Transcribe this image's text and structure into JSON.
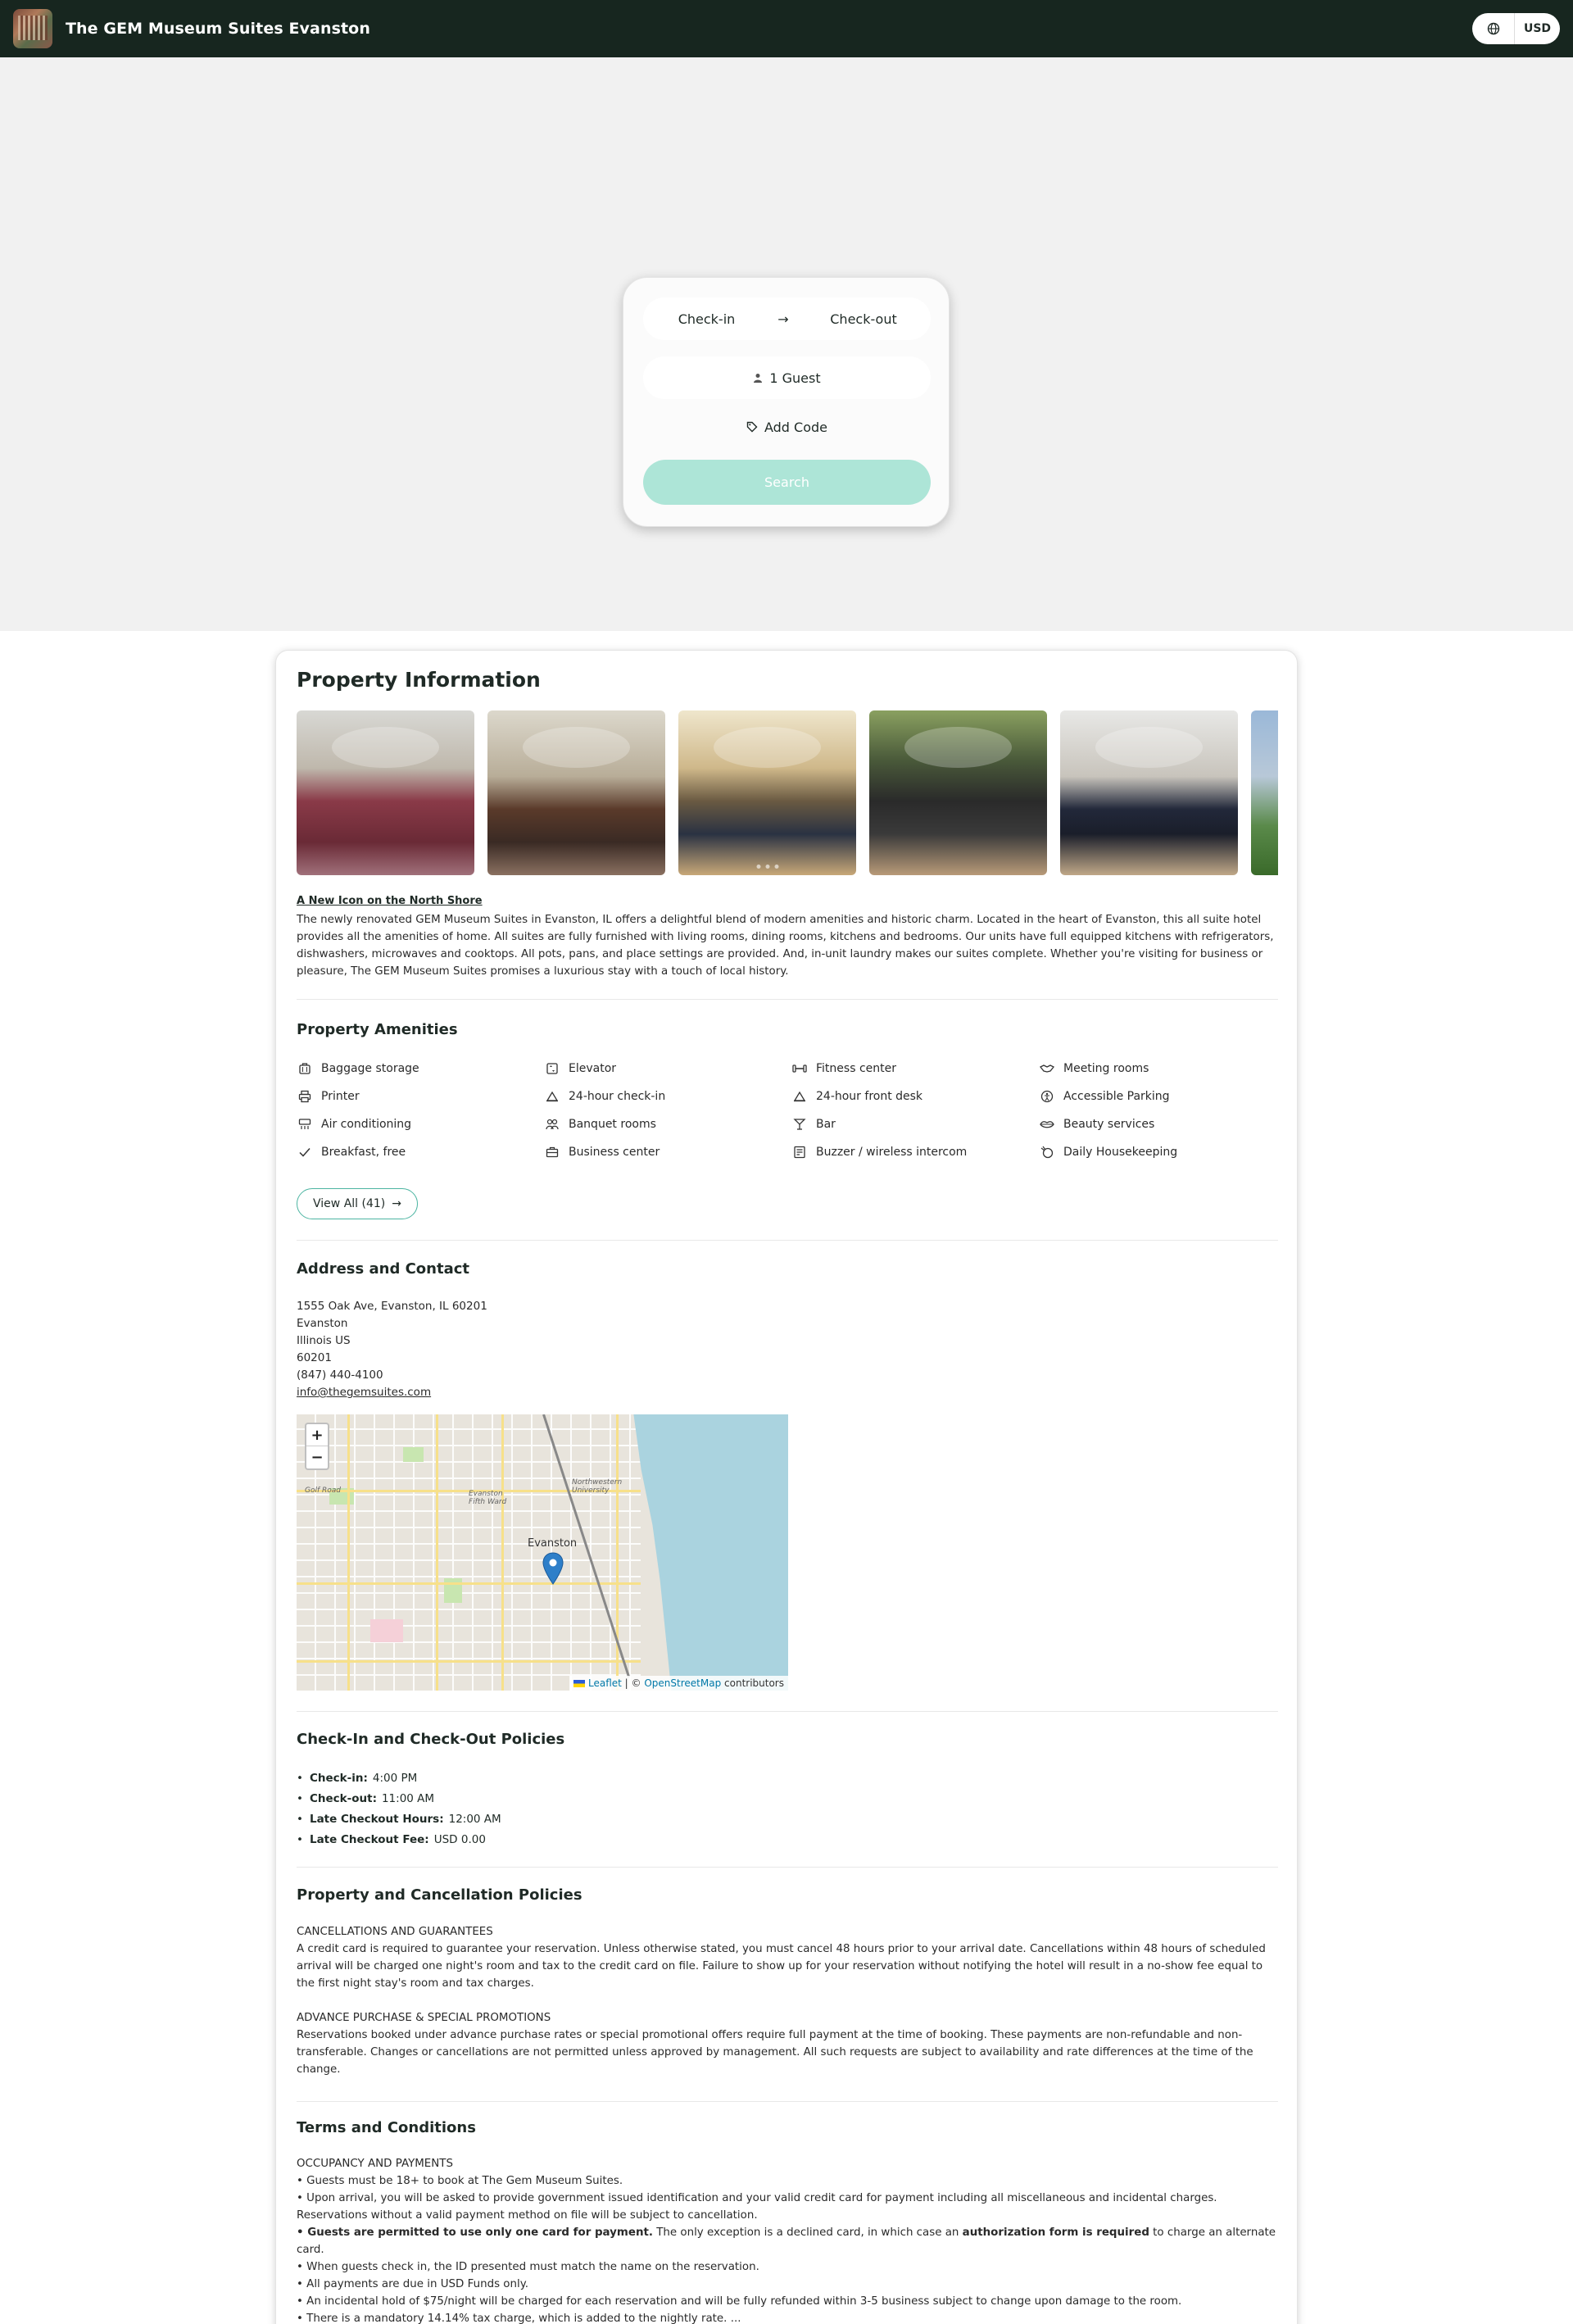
{
  "header": {
    "hotel_name": "The GEM Museum Suites Evanston",
    "currency": "USD"
  },
  "booking": {
    "check_in": "Check-in",
    "check_out": "Check-out",
    "guests": "1 Guest",
    "add_code": "Add Code",
    "search": "Search"
  },
  "property": {
    "title": "Property Information",
    "desc_title": "A New Icon on the North Shore",
    "description": "The newly renovated GEM Museum Suites in Evanston, IL offers a delightful blend of modern amenities and historic charm. Located in the heart of Evanston, this all suite hotel provides all the amenities of home.  All suites are fully furnished with living rooms, dining rooms, kitchens and bedrooms.  Our units have full equipped kitchens with refrigerators, dishwashers, microwaves and cooktops.  All pots, pans, and place settings are provided. And, in-unit laundry makes our suites complete. Whether you're visiting for business or pleasure, The GEM Museum Suites promises a luxurious stay with a touch of local history."
  },
  "amenities": {
    "title": "Property Amenities",
    "items": [
      {
        "label": "Baggage storage",
        "icon": "luggage-icon"
      },
      {
        "label": "Elevator",
        "icon": "elevator-icon"
      },
      {
        "label": "Fitness center",
        "icon": "dumbbell-icon"
      },
      {
        "label": "Meeting rooms",
        "icon": "handshake-icon"
      },
      {
        "label": "Printer",
        "icon": "printer-icon"
      },
      {
        "label": "24-hour check-in",
        "icon": "bell-icon"
      },
      {
        "label": "24-hour front desk",
        "icon": "bell-icon"
      },
      {
        "label": "Accessible Parking",
        "icon": "accessibility-icon"
      },
      {
        "label": "Air conditioning",
        "icon": "air-conditioner-icon"
      },
      {
        "label": "Banquet rooms",
        "icon": "banquet-icon"
      },
      {
        "label": "Bar",
        "icon": "cocktail-icon"
      },
      {
        "label": "Beauty services",
        "icon": "lips-icon"
      },
      {
        "label": "Breakfast, free",
        "icon": "check-icon"
      },
      {
        "label": "Business center",
        "icon": "briefcase-icon"
      },
      {
        "label": "Buzzer / wireless intercom",
        "icon": "intercom-icon"
      },
      {
        "label": "Daily Housekeeping",
        "icon": "housekeeping-icon"
      }
    ],
    "view_all": "View All (41)"
  },
  "address": {
    "title": "Address and Contact",
    "street": "1555 Oak Ave, Evanston, IL 60201",
    "city": "Evanston",
    "state": "Illinois US",
    "zip": "60201",
    "phone": "(847) 440-4100",
    "email": "info@thegemsuites.com"
  },
  "map": {
    "zoom_in": "+",
    "zoom_out": "−",
    "city_label": "Evanston",
    "label_golf": "Golf Road",
    "label_fifth_ward": "Evanston Fifth Ward",
    "label_university": "Northwestern University",
    "attr_leaflet": "Leaflet",
    "attr_sep": " | © ",
    "attr_osm": "OpenStreetMap",
    "attr_contrib": " contributors"
  },
  "checkin": {
    "title": "Check-In and Check-Out Policies",
    "items": [
      {
        "label": "Check-in:",
        "value": "4:00 PM"
      },
      {
        "label": "Check-out:",
        "value": "11:00 AM"
      },
      {
        "label": "Late Checkout Hours:",
        "value": "12:00 AM"
      },
      {
        "label": "Late Checkout Fee:",
        "value": "USD 0.00"
      }
    ]
  },
  "cancellation": {
    "title": "Property and Cancellation Policies",
    "h1": "CANCELLATIONS AND GUARANTEES",
    "p1": "A credit card is required to guarantee your reservation. Unless otherwise stated, you must cancel 48 hours prior to your arrival date. Cancellations within 48 hours of scheduled arrival will be charged one night's room and tax to the credit card on file. Failure to show up for your reservation without notifying the hotel will result in a no-show fee equal to the first night stay's room and tax charges.",
    "h2": "ADVANCE PURCHASE & SPECIAL PROMOTIONS",
    "p2": "Reservations booked under advance purchase rates or special promotional offers require full payment at the time of booking. These payments are non-refundable and non-transferable. Changes or cancellations are not permitted unless approved by management. All such requests are subject to availability and rate differences at the time of the change."
  },
  "terms": {
    "title": "Terms and Conditions",
    "h1": "OCCUPANCY AND PAYMENTS",
    "l1": "• Guests must be 18+ to book at The Gem Museum Suites.",
    "l2": "• Upon arrival, you will be asked to provide government issued identification and your valid credit card for payment including all miscellaneous and incidental charges. Reservations without a valid payment method on file will be subject to cancellation.",
    "l3a": "• Guests are permitted to use only one card for payment.",
    "l3b": " The only exception is a declined card, in which case an ",
    "l3c": "authorization form is required",
    "l3d": " to charge an alternate card.",
    "l4": "• When guests check in, the ID presented must match the name on the reservation.",
    "l5": "• All payments are due in USD Funds only.",
    "l6": "• An incidental hold of $75/night will be charged for each reservation and will be fully refunded within 3-5 business subject to change upon damage to the room.",
    "l7": "• There is a mandatory 14.14% tax charge, which is added to the nightly rate. ..."
  }
}
